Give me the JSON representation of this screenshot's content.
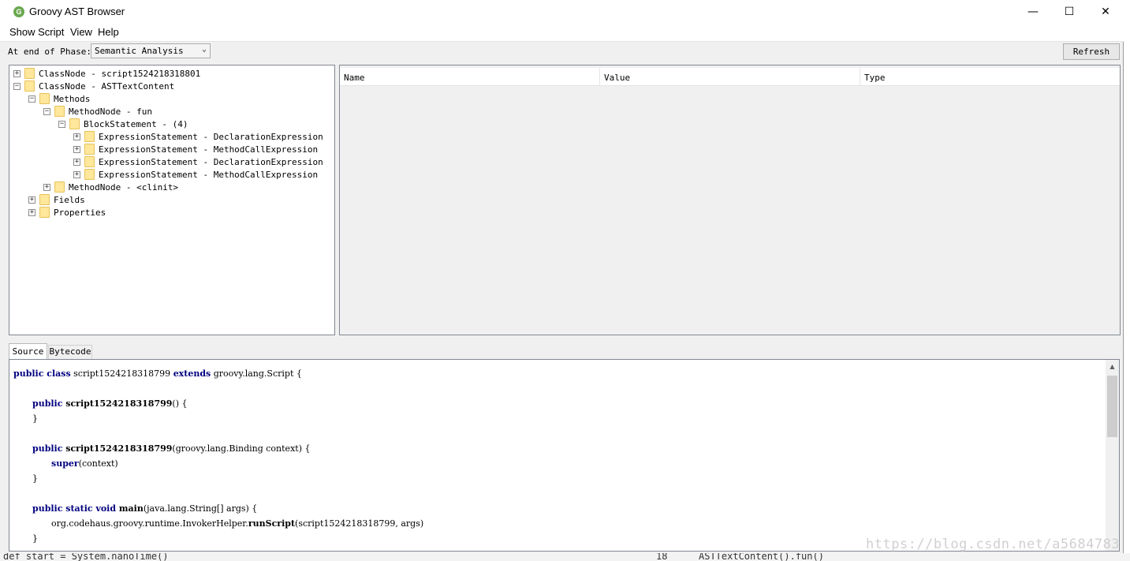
{
  "window": {
    "title": "Groovy AST Browser",
    "icon": "groovy-icon",
    "controls": [
      "minimize",
      "maximize",
      "close"
    ]
  },
  "menubar": {
    "show_script": "Show Script",
    "view": "View",
    "help": "Help"
  },
  "toolbar": {
    "phase_label": "At end of Phase:",
    "phase_value": "Semantic Analysis",
    "refresh_label": "Refresh"
  },
  "tree": [
    {
      "label": "ClassNode - script1524218318801",
      "expanded": false
    },
    {
      "label": "ClassNode - ASTTextContent",
      "expanded": true
    },
    {
      "label": "Methods",
      "expanded": true
    },
    {
      "label": "MethodNode - fun",
      "expanded": true
    },
    {
      "label": "BlockStatement - (4)",
      "expanded": true
    },
    {
      "label": "ExpressionStatement - DeclarationExpression",
      "expanded": false
    },
    {
      "label": "ExpressionStatement - MethodCallExpression",
      "expanded": false
    },
    {
      "label": "ExpressionStatement - DeclarationExpression",
      "expanded": false
    },
    {
      "label": "ExpressionStatement - MethodCallExpression",
      "expanded": false
    },
    {
      "label": "MethodNode - <clinit>",
      "expanded": false
    },
    {
      "label": "Fields",
      "expanded": false
    },
    {
      "label": "Properties",
      "expanded": false
    }
  ],
  "table": {
    "columns": [
      "Name",
      "Value",
      "Type"
    ]
  },
  "tabs": {
    "source": "Source",
    "bytecode": "Bytecode"
  },
  "source_code": {
    "l1": {
      "k1": "public class",
      "t1": " script1524218318799 ",
      "k2": "extends",
      "t2": " groovy.lang.Script {"
    },
    "l2": {
      "k1": "public",
      "m1": " script1524218318799",
      "t1": "() {"
    },
    "l3": "}",
    "l4": {
      "k1": "public",
      "m1": " script1524218318799",
      "t1": "(groovy.lang.Binding context) {"
    },
    "l5": {
      "k1": "super",
      "t1": "(context)"
    },
    "l6": "}",
    "l7": {
      "k1": "public static void",
      "m1": " main",
      "t1": "(java.lang.String[] args) {"
    },
    "l8": {
      "t0": "org.codehaus.groovy.runtime.InvokerHelper.",
      "m1": "runScript",
      "t1": "(script1524218318799, args)"
    },
    "l9": "}"
  },
  "background": {
    "bottom_text": "def start = System.nanoTime()",
    "bottom_text_right": "ASTTextContent().fun()",
    "bottom_line_no": "18"
  },
  "watermark": "https://blog.csdn.net/a5684783"
}
